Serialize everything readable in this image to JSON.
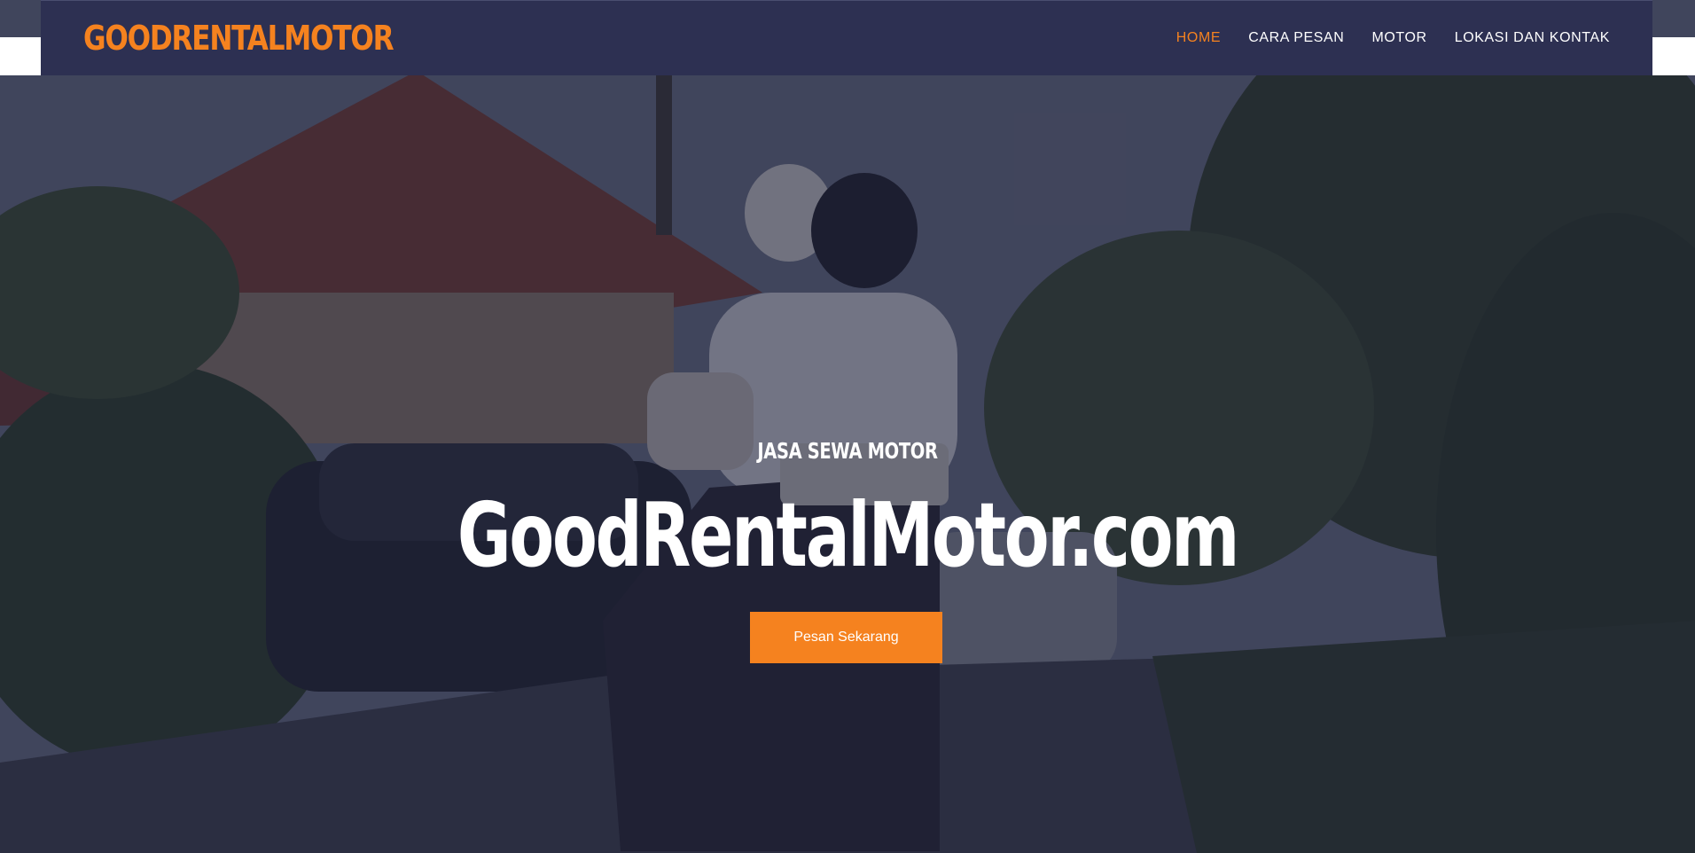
{
  "brand": {
    "name": "GOODRENTALMOTOR"
  },
  "nav": {
    "items": [
      {
        "label": "HOME",
        "active": true
      },
      {
        "label": "CARA PESAN",
        "active": false
      },
      {
        "label": "MOTOR",
        "active": false
      },
      {
        "label": "LOKASI DAN KONTAK",
        "active": false
      }
    ]
  },
  "hero": {
    "subtitle": "JASA SEWA MOTOR",
    "headline": "GoodRentalMotor.com",
    "cta_label": "Pesan Sekarang",
    "background_image": "motorcycle-rider-on-village-road-photo"
  },
  "colors": {
    "accent": "#f5821f",
    "navbar_bg": "#2d3052",
    "text_light": "#ffffff"
  }
}
